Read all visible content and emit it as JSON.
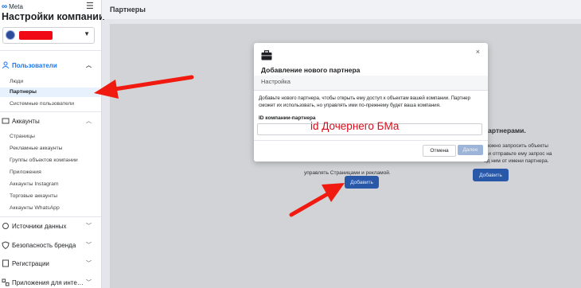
{
  "app": {
    "brand": "Meta",
    "title": "Настройки компании"
  },
  "sidebar": {
    "groups": [
      {
        "label": "Пользователи",
        "items": [
          "Люди",
          "Партнеры",
          "Системные пользователи"
        ]
      },
      {
        "label": "Аккаунты",
        "items": [
          "Страницы",
          "Рекламные аккаунты",
          "Группы объектов компании",
          "Приложения",
          "Аккаунты Instagram",
          "Торговые аккаунты",
          "Аккаунты WhatsApp"
        ]
      },
      {
        "label": "Источники данных"
      },
      {
        "label": "Безопасность бренда"
      },
      {
        "label": "Регистрации"
      },
      {
        "label": "Приложения для инте…"
      }
    ]
  },
  "main": {
    "title": "Партнеры",
    "panel": {
      "right_heading": "партнерами.",
      "right_text_1": "южно запросить объекты",
      "right_text_2": "и и отправьте ему запрос на",
      "right_text_3": "ад ним от имени партнера.",
      "left_text": "управлять Страницами и рекламой.",
      "add_button": "Добавить",
      "add_button_right": "Добавить"
    }
  },
  "modal": {
    "title": "Добавление нового партнера",
    "subtitle": "Настройка",
    "description": "Добавьте нового партнера, чтобы открыть ему доступ к объектам вашей компании. Партнер сможет их использовать, но управлять ими по-прежнему будет ваша компания.",
    "field_label": "ID компании-партнера",
    "field_value": "id Дочернего БМа",
    "cancel": "Отмена",
    "next": "Далее",
    "close": "×"
  },
  "colors": {
    "accent": "#1877f2",
    "annotation": "#f01a10",
    "button": "#2a58a8"
  }
}
